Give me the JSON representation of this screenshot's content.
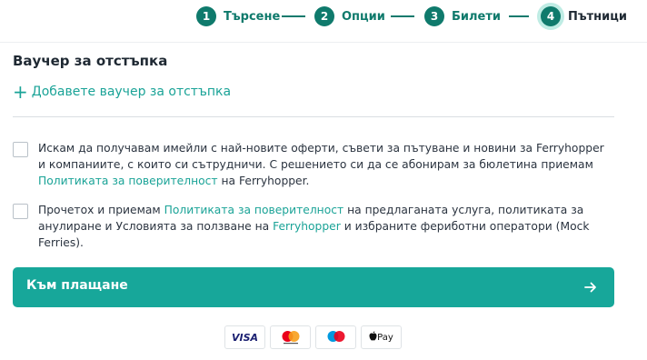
{
  "stepper": {
    "steps": [
      {
        "num": "1",
        "label": "Търсене"
      },
      {
        "num": "2",
        "label": "Опции"
      },
      {
        "num": "3",
        "label": "Билети"
      },
      {
        "num": "4",
        "label": "Пътници"
      }
    ],
    "active_step": "4"
  },
  "voucher": {
    "title": "Ваучер за отстъпка",
    "add_label": "Добавете ваучер за отстъпка"
  },
  "newsletter": {
    "text_before": "Искам да получавам имейли с най-новите оферти, съвети за пътуване и новини за Ferryhopper и компаниите, с които си сътрудничи. С решението си да се абонирам за бюлетина приемам ",
    "privacy_link": "Политиката за поверителност",
    "text_after": " на Ferryhopper."
  },
  "terms": {
    "text_1": "Прочетох и приемам ",
    "privacy_link": "Политиката за поверителност",
    "text_2": " на предлаганата услуга, политиката за анулиране и Условията за ползване на ",
    "ferryhopper_link": "Ferryhopper",
    "text_3": " и избраните фериботни оператори (Mock Ferries)."
  },
  "checkout": {
    "button_label": "Към плащане",
    "arrow_icon": "arrow-right-icon"
  },
  "payment_methods": {
    "visa_label": "VISA",
    "applepay_label": " Pay"
  },
  "colors": {
    "accent": "#17a79a",
    "step_dark": "#0f7a6c",
    "link": "#1aa397",
    "active_ring": "#bfece4"
  }
}
